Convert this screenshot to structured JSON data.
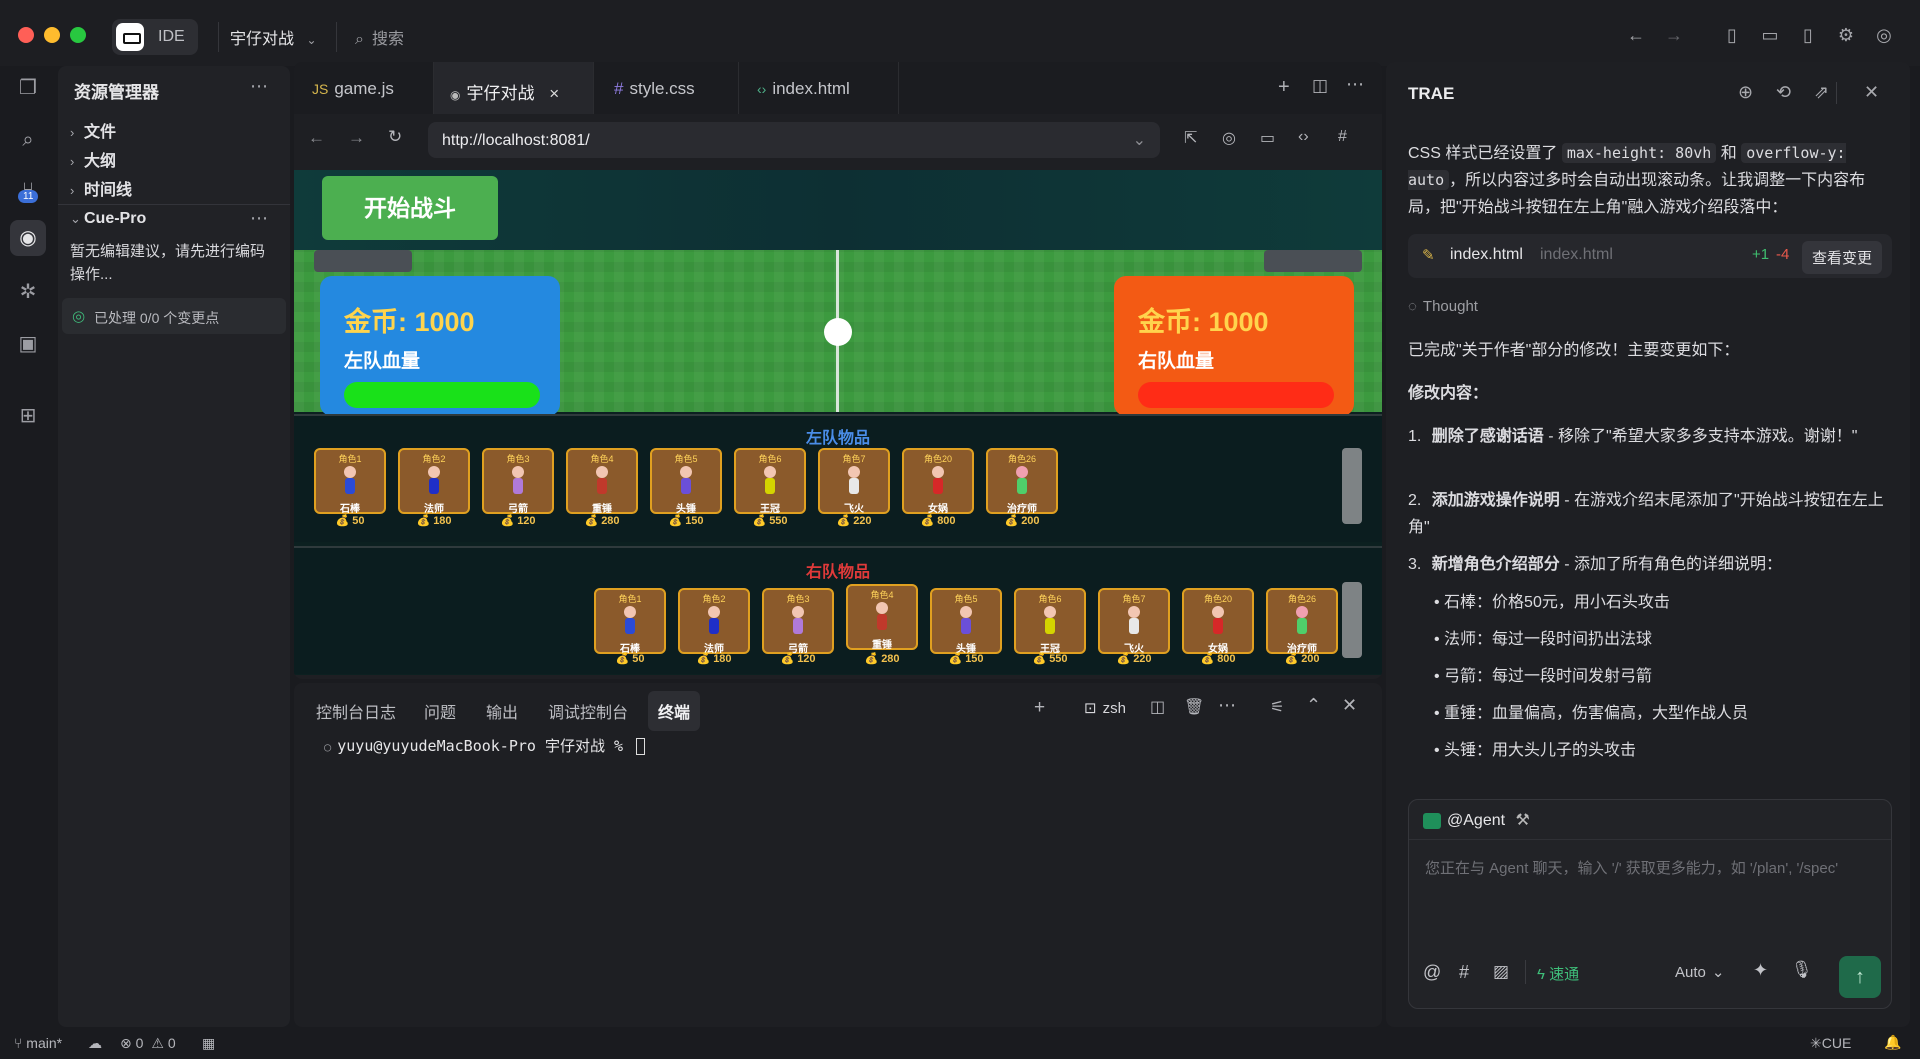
{
  "titlebar": {
    "ide_label": "IDE",
    "project_name": "宇仔对战",
    "search_label": "搜索"
  },
  "activity": {
    "badge_count": "11"
  },
  "sidebar": {
    "title": "资源管理器",
    "sections": [
      "文件",
      "大纲",
      "时间线"
    ],
    "cue_title": "Cue-Pro",
    "cue_message": "暂无编辑建议，请先进行编码操作...",
    "cue_status": "已处理 0/0 个变更点"
  },
  "editor": {
    "tabs": [
      {
        "prefix": "JS",
        "label": "game.js"
      },
      {
        "prefix": "◉",
        "label": "宇仔对战",
        "close": "×"
      },
      {
        "prefix": "#",
        "label": "style.css"
      },
      {
        "prefix": "‹›",
        "label": "index.html"
      }
    ],
    "url": "http://localhost:8081/"
  },
  "game": {
    "start_button": "开始战斗",
    "left": {
      "gold": "金币: 1000",
      "hp_label": "左队血量",
      "color": "#1e88e5"
    },
    "right": {
      "gold": "金币: 1000",
      "hp_label": "右队血量",
      "color": "#f4511e"
    },
    "left_items_title": "左队物品",
    "right_items_title": "右队物品",
    "cards": [
      {
        "label": "角色1",
        "name": "石棒",
        "price": "💰 50"
      },
      {
        "label": "角色2",
        "name": "法师",
        "price": "💰 180"
      },
      {
        "label": "角色3",
        "name": "弓箭",
        "price": "💰 120"
      },
      {
        "label": "角色4",
        "name": "重锤",
        "price": "💰 280"
      },
      {
        "label": "角色5",
        "name": "头锤",
        "price": "💰 150"
      },
      {
        "label": "角色6",
        "name": "王冠",
        "price": "💰 550"
      },
      {
        "label": "角色7",
        "name": "飞火",
        "price": "💰 220"
      },
      {
        "label": "角色20",
        "name": "女娲",
        "price": "💰 800"
      },
      {
        "label": "角色26",
        "name": "治疗师",
        "price": "💰 200"
      }
    ]
  },
  "panel": {
    "tabs": [
      "控制台日志",
      "问题",
      "输出",
      "调试控制台",
      "终端"
    ],
    "shell": "zsh",
    "prompt": "yuyu@yuyudeMacBook-Pro 宇仔对战 %"
  },
  "assistant": {
    "title": "TRAE",
    "intro_1": "CSS 样式已经设置了",
    "code_1": "max-height: 80vh",
    "intro_and": "和",
    "code_2": "overflow-y: auto",
    "intro_2": "，所以内容过多时会自动出现滚动条。让我调整一下内容布局，把\"开始战斗按钮在左上角\"融入游戏介绍段落中：",
    "file_name": "index.html",
    "file_path": "index.html",
    "diff_add": "+1",
    "diff_del": "-4",
    "view_changes": "查看变更",
    "thought": "Thought",
    "done": "已完成\"关于作者\"部分的修改！主要变更如下：",
    "heading": "修改内容：",
    "changes": [
      {
        "num": "1.",
        "bold": "删除了感谢话语",
        "text": " - 移除了\"希望大家多多支持本游戏。谢谢！\""
      },
      {
        "num": "2.",
        "bold": "添加游戏操作说明",
        "text": " - 在游戏介绍末尾添加了\"开始战斗按钮在左上角\""
      },
      {
        "num": "3.",
        "bold": "新增角色介绍部分",
        "text": " - 添加了所有角色的详细说明："
      }
    ],
    "roles": [
      "石棒：价格50元，用小石头攻击",
      "法师：每过一段时间扔出法球",
      "弓箭：每过一段时间发射弓箭",
      "重锤：血量偏高，伤害偏高，大型作战人员",
      "头锤：用大头儿子的头攻击"
    ],
    "agent_label": "@Agent",
    "placeholder": "您正在与 Agent 聊天，输入 '/' 获取更多能力，如 '/plan', '/spec'",
    "mode": "速通",
    "model": "Auto"
  },
  "statusbar": {
    "branch": "main*",
    "errors": "0",
    "warnings": "0",
    "cue": "CUE"
  }
}
